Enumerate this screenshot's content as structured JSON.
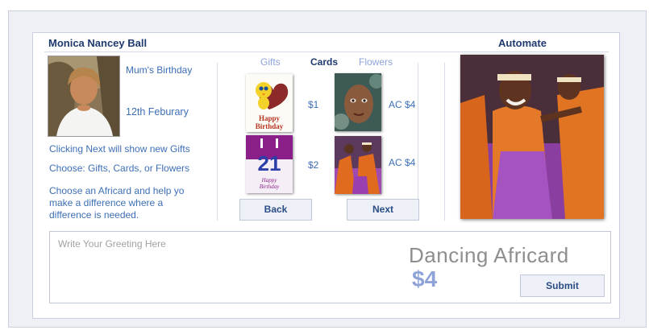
{
  "user": {
    "name": "Monica Nancey Ball"
  },
  "header": {
    "automate_label": "Automate"
  },
  "event": {
    "title": "Mum's Birthday",
    "date": "12th Feburary"
  },
  "info": {
    "line1": "Clicking Next will show new Gifts",
    "line2": "Choose: Gifts, Cards, or Flowers",
    "line3": "Choose an Africard and help yo make a difference where a difference is needed."
  },
  "tabs": [
    {
      "label": "Gifts",
      "active": false
    },
    {
      "label": "Cards",
      "active": true
    },
    {
      "label": "Flowers",
      "active": false
    }
  ],
  "cards": [
    {
      "name": "tweety-happy-birthday-card",
      "price": "$1"
    },
    {
      "name": "twenty-one-happy-birthday-card",
      "price": "$2"
    },
    {
      "name": "african-child-portrait-card",
      "price": "AC $4"
    },
    {
      "name": "african-dancers-card",
      "price": "AC $4"
    }
  ],
  "nav": {
    "back_label": "Back",
    "next_label": "Next"
  },
  "greeting": {
    "placeholder": "Write Your Greeting Here",
    "value": ""
  },
  "selection": {
    "card_name": "Dancing Africard",
    "amount": "$4"
  },
  "submit_label": "Submit",
  "colors": {
    "accent_blue": "#3d6fb5",
    "title_navy": "#1f3a6e",
    "amount_blue": "#8fa3d8"
  }
}
